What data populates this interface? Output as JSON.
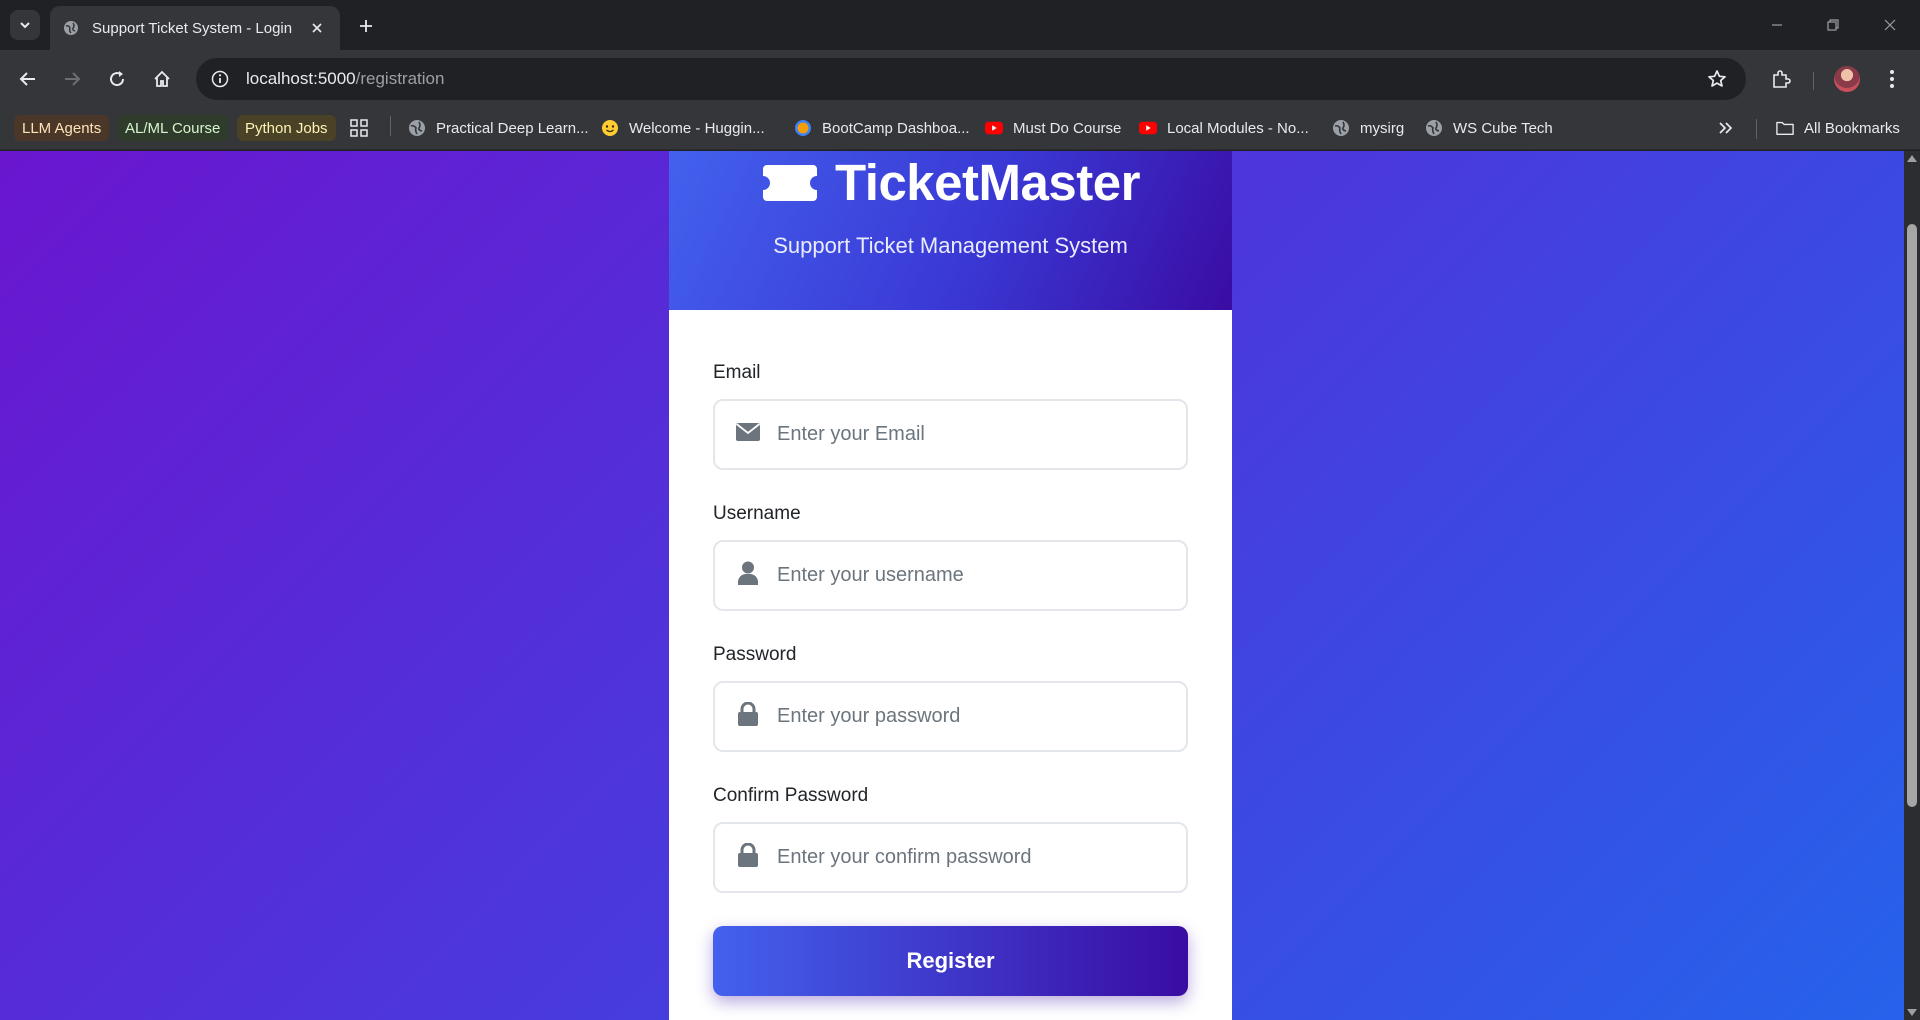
{
  "browser": {
    "tab": {
      "title": "Support Ticket System - Login",
      "favicon": "globe-icon"
    },
    "url": {
      "host": "localhost:5000",
      "path": "/registration"
    },
    "bookmarks": [
      {
        "label": "LLM Agents",
        "chip_bg": "#4a3728",
        "chip_fg": "#fde2b8"
      },
      {
        "label": "AL/ML Course",
        "chip_bg": "#2f3b2b",
        "chip_fg": "#d8f5cf"
      },
      {
        "label": "Python Jobs",
        "chip_bg": "#4a4226",
        "chip_fg": "#fdf1b5"
      },
      {
        "label": "Practical Deep Learn...",
        "icon": "globe-icon"
      },
      {
        "label": "Welcome - Huggin...",
        "icon": "hugging-face-icon"
      },
      {
        "label": "BootCamp Dashboa...",
        "icon": "bootcamp-icon"
      },
      {
        "label": "Must Do Course",
        "icon": "youtube-icon"
      },
      {
        "label": "Local Modules - No...",
        "icon": "youtube-icon"
      },
      {
        "label": "mysirg",
        "icon": "globe-icon"
      },
      {
        "label": "WS Cube Tech",
        "icon": "globe-icon"
      }
    ],
    "all_bookmarks_label": "All Bookmarks"
  },
  "page": {
    "brand": {
      "name": "TicketMaster",
      "subtitle": "Support Ticket Management System",
      "icon": "ticket-icon"
    },
    "form": {
      "email": {
        "label": "Email",
        "placeholder": "Enter your Email",
        "icon": "envelope-icon"
      },
      "username": {
        "label": "Username",
        "placeholder": "Enter your username",
        "icon": "user-icon"
      },
      "password": {
        "label": "Password",
        "placeholder": "Enter your password",
        "icon": "lock-icon"
      },
      "confirm_password": {
        "label": "Confirm Password",
        "placeholder": "Enter your confirm password",
        "icon": "lock-icon"
      },
      "submit_label": "Register"
    },
    "colors": {
      "gradient_start": "#6a16cf",
      "gradient_end": "#2563eb",
      "accent": "#4361ee",
      "accent_dark": "#3a0ca3"
    }
  }
}
